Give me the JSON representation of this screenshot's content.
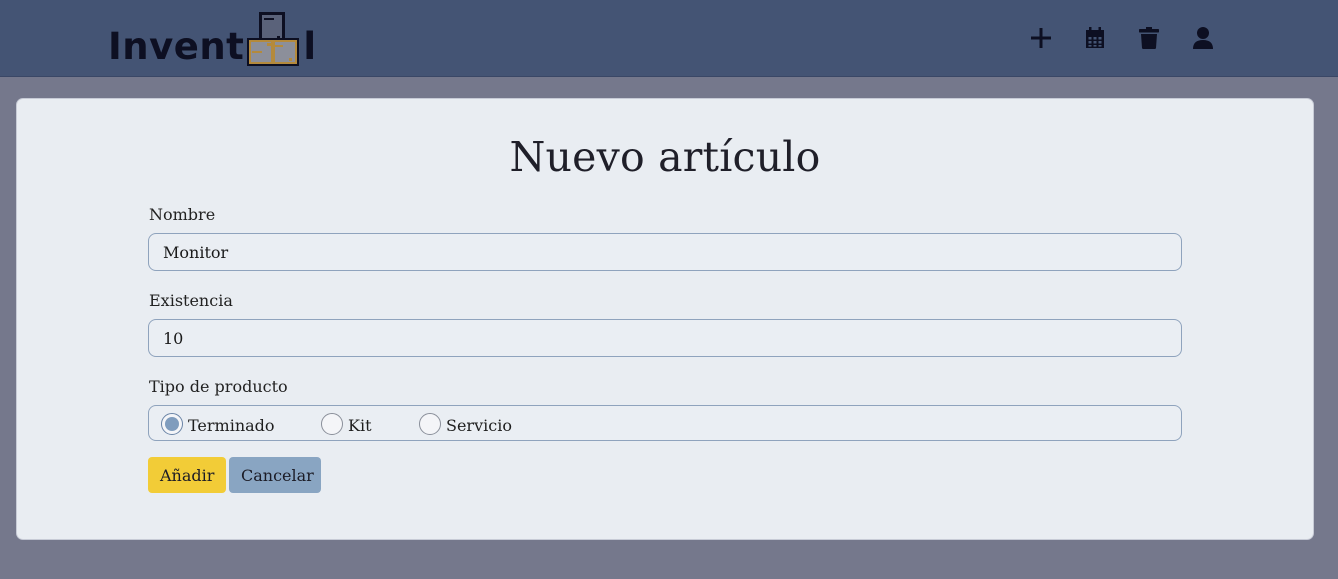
{
  "header": {
    "logo_text": "Invent",
    "logo_suffix": "l",
    "icons": [
      "plus-icon",
      "calendar-icon",
      "trash-icon",
      "user-icon"
    ]
  },
  "form": {
    "title": "Nuevo artículo",
    "name_label": "Nombre",
    "name_value": "Monitor",
    "stock_label": "Existencia",
    "stock_value": "10",
    "type_label": "Tipo de producto",
    "type_options": [
      "Terminado",
      "Kit",
      "Servicio"
    ],
    "type_selected": "Terminado",
    "add_label": "Añadir",
    "cancel_label": "Cancelar"
  },
  "colors": {
    "header_bg": "#445474",
    "page_bg": "#75788c",
    "card_bg": "#e9edf2",
    "add_button": "#f2cc37",
    "cancel_button": "#89a5c2"
  }
}
